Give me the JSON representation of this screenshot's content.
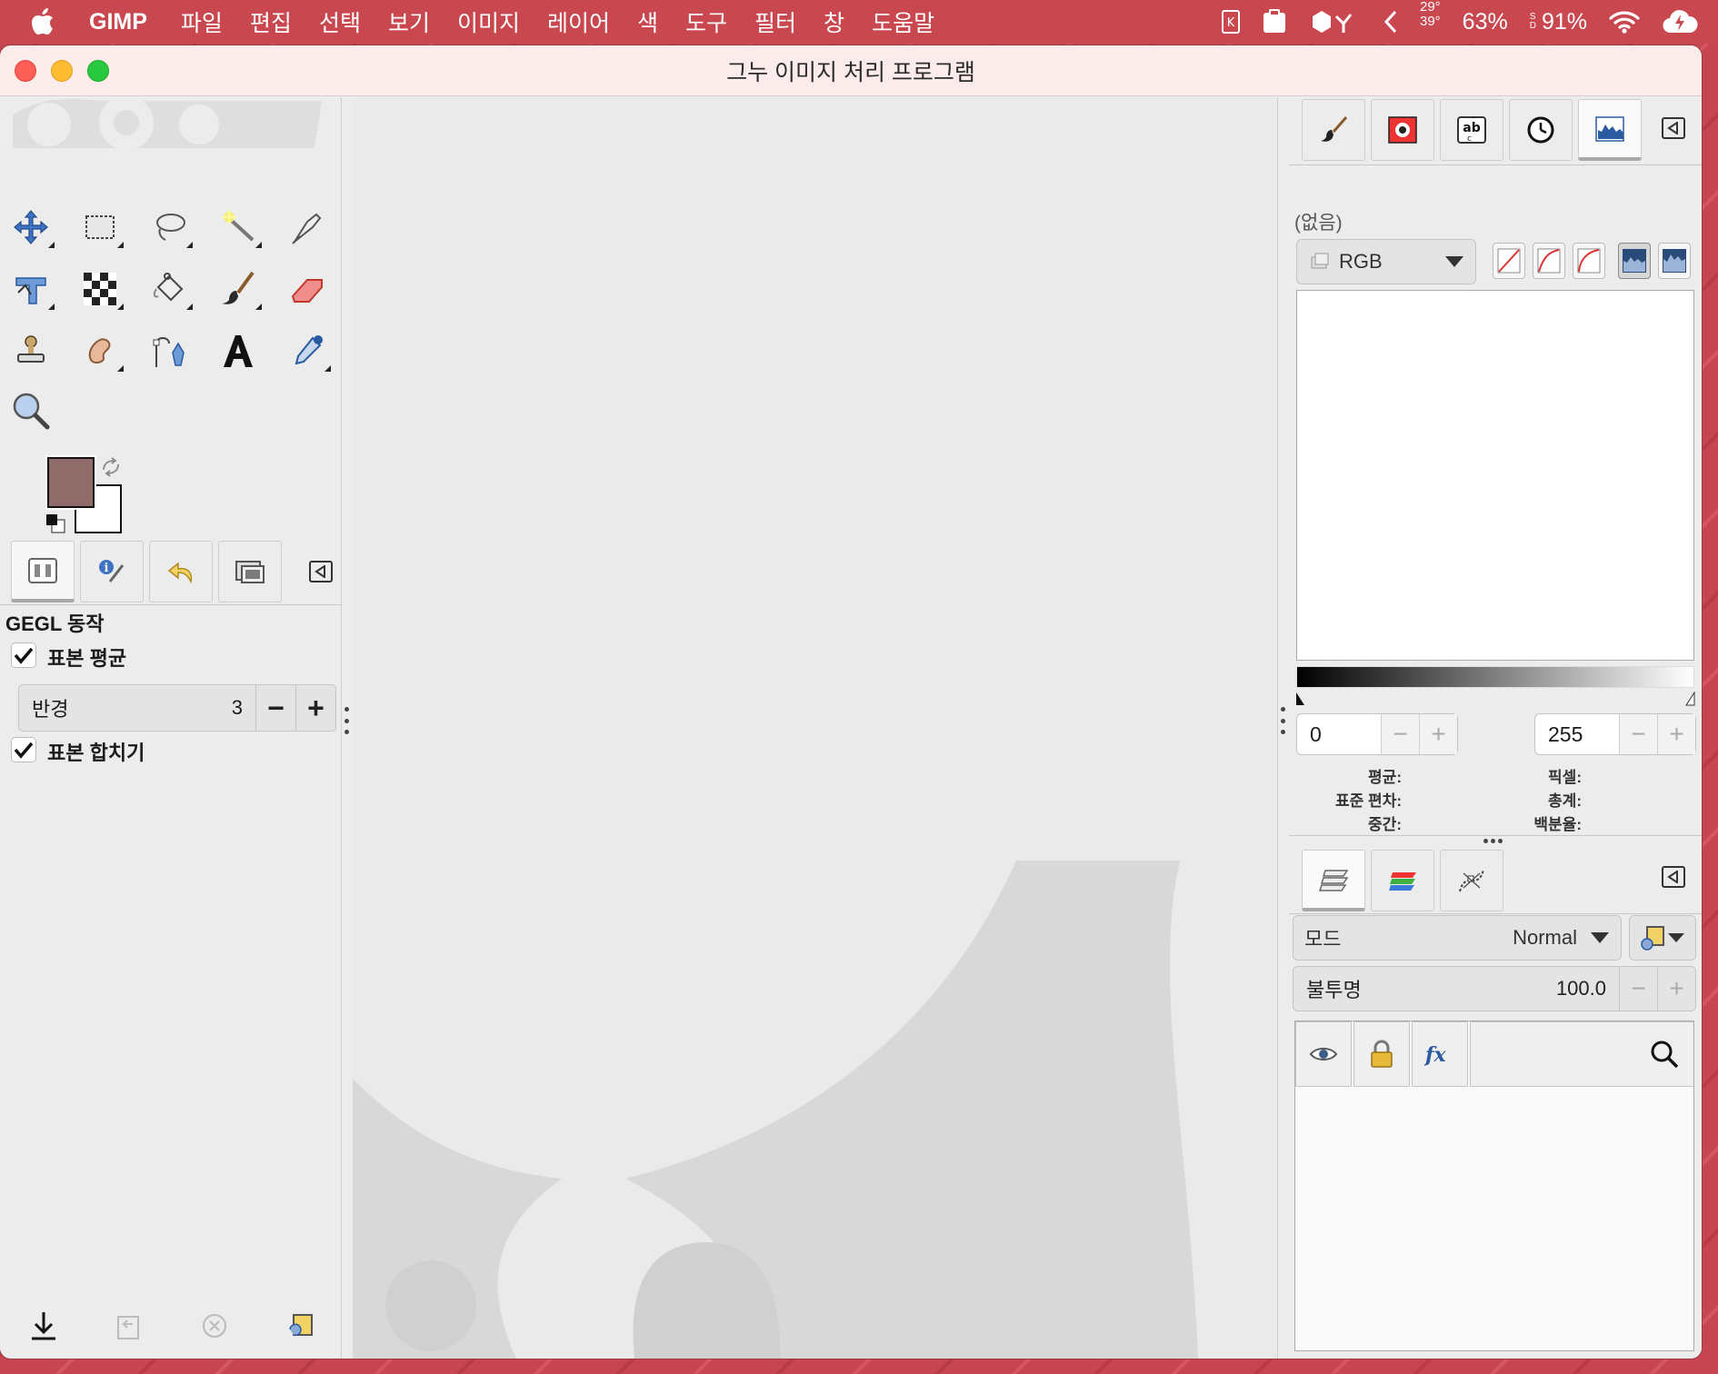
{
  "menubar": {
    "app": "GIMP",
    "items": [
      "파일",
      "편집",
      "선택",
      "보기",
      "이미지",
      "레이어",
      "색",
      "도구",
      "필터",
      "창",
      "도움말"
    ],
    "temp_top": "29°",
    "temp_bottom": "39°",
    "cpu": "63%",
    "ssd_label_top": "S",
    "ssd_label_bottom": "D",
    "battery": "91%"
  },
  "window": {
    "title": "그누 이미지 처리 프로그램"
  },
  "tool_options": {
    "heading": "GEGL 동작",
    "sample_average_label": "표본 평균",
    "sample_average_checked": true,
    "radius_label": "반경",
    "radius_value": "3",
    "sample_merged_label": "표본 합치기",
    "sample_merged_checked": true
  },
  "colors": {
    "foreground": "#8f6c6a",
    "background": "#ffffff"
  },
  "histogram": {
    "source": "(없음)",
    "channel": "RGB",
    "range_min": "0",
    "range_max": "255",
    "stats_left": [
      "평균:",
      "표준 편차:",
      "중간:"
    ],
    "stats_right": [
      "픽셀:",
      "총계:",
      "백분율:"
    ]
  },
  "layers": {
    "mode_label": "모드",
    "mode_value": "Normal",
    "opacity_label": "불투명",
    "opacity_value": "100.0"
  }
}
